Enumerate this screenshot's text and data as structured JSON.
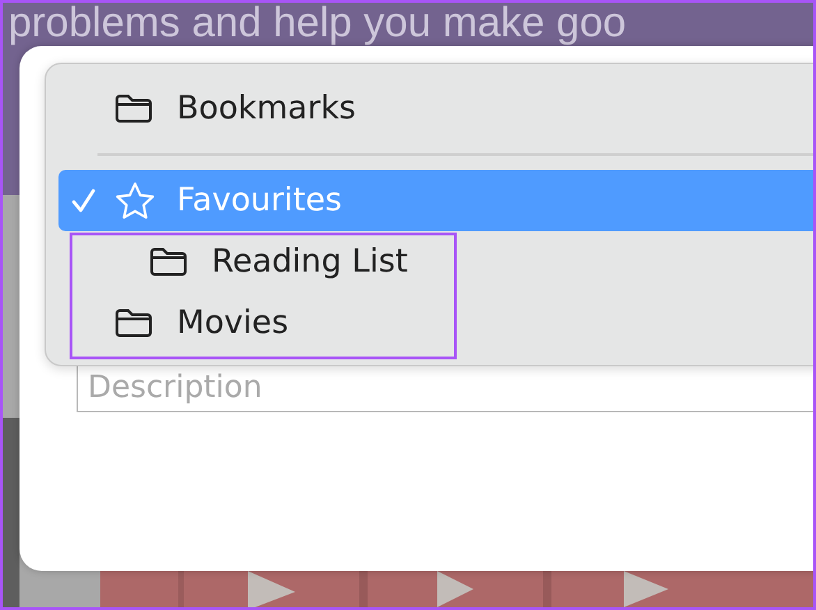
{
  "background": {
    "heading": "problems and help you make goo"
  },
  "dialog": {
    "description_field": {
      "placeholder": "Description"
    }
  },
  "menu": {
    "items": [
      {
        "kind": "folder",
        "label": "Bookmarks",
        "selected": false
      },
      {
        "kind": "separator"
      },
      {
        "kind": "favorites",
        "label": "Favourites",
        "selected": true,
        "children": [
          {
            "kind": "folder",
            "label": "Reading List",
            "selected": false
          }
        ]
      },
      {
        "kind": "folder",
        "label": "Movies",
        "selected": false
      }
    ]
  }
}
